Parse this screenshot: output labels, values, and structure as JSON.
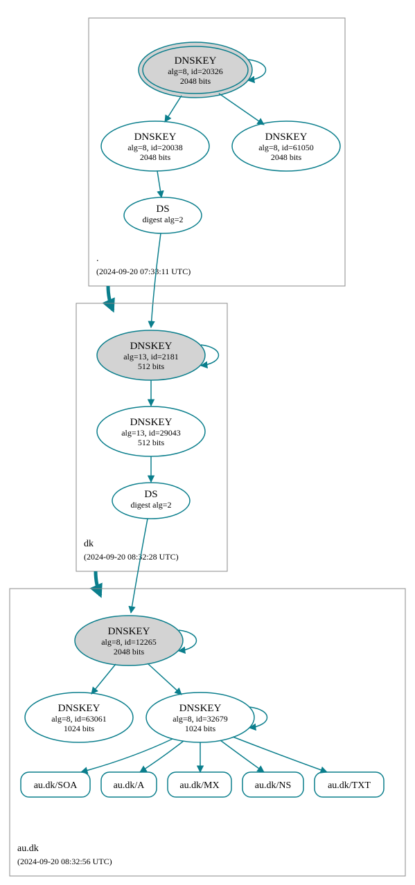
{
  "colors": {
    "stroke": "#0a7e8c",
    "ksk_fill": "#d3d3d3"
  },
  "zones": {
    "root": {
      "label": ".",
      "timestamp": "(2024-09-20 07:33:11 UTC)",
      "nodes": {
        "ksk": {
          "title": "DNSKEY",
          "line1": "alg=8, id=20326",
          "line2": "2048 bits"
        },
        "zsk1": {
          "title": "DNSKEY",
          "line1": "alg=8, id=20038",
          "line2": "2048 bits"
        },
        "zsk2": {
          "title": "DNSKEY",
          "line1": "alg=8, id=61050",
          "line2": "2048 bits"
        },
        "ds": {
          "title": "DS",
          "line1": "digest alg=2"
        }
      }
    },
    "dk": {
      "label": "dk",
      "timestamp": "(2024-09-20 08:32:28 UTC)",
      "nodes": {
        "ksk": {
          "title": "DNSKEY",
          "line1": "alg=13, id=2181",
          "line2": "512 bits"
        },
        "zsk": {
          "title": "DNSKEY",
          "line1": "alg=13, id=29043",
          "line2": "512 bits"
        },
        "ds": {
          "title": "DS",
          "line1": "digest alg=2"
        }
      }
    },
    "audk": {
      "label": "au.dk",
      "timestamp": "(2024-09-20 08:32:56 UTC)",
      "nodes": {
        "ksk": {
          "title": "DNSKEY",
          "line1": "alg=8, id=12265",
          "line2": "2048 bits"
        },
        "zsk1": {
          "title": "DNSKEY",
          "line1": "alg=8, id=63061",
          "line2": "1024 bits"
        },
        "zsk2": {
          "title": "DNSKEY",
          "line1": "alg=8, id=32679",
          "line2": "1024 bits"
        }
      },
      "records": {
        "soa": "au.dk/SOA",
        "a": "au.dk/A",
        "mx": "au.dk/MX",
        "ns": "au.dk/NS",
        "txt": "au.dk/TXT"
      }
    }
  }
}
